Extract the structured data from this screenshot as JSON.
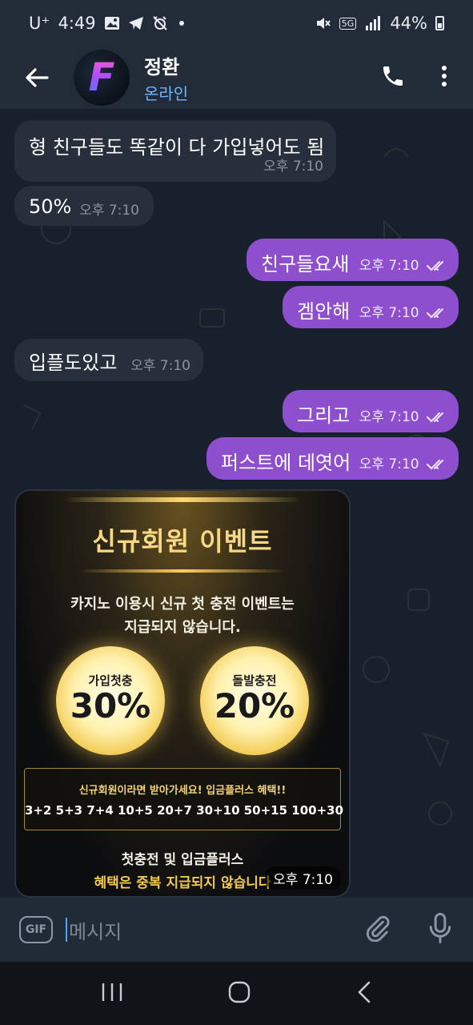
{
  "status_bar": {
    "carrier": "U⁺",
    "time": "4:49",
    "battery": "44%",
    "network": "5G"
  },
  "header": {
    "avatar_letter": "F",
    "contact_name": "정환",
    "status": "온라인",
    "back_icon": "arrow-left-icon",
    "call_icon": "phone-icon",
    "menu_icon": "more-vertical-icon"
  },
  "messages": [
    {
      "dir": "in",
      "text": "형 친구들도 똑같이 다 가입넣어도 됨",
      "time": "오후 7:10"
    },
    {
      "dir": "in",
      "text": "50%",
      "time": "오후 7:10"
    },
    {
      "dir": "out",
      "text": "친구들요새",
      "time": "오후 7:10",
      "read": true
    },
    {
      "dir": "out",
      "text": "겜안해",
      "time": "오후 7:10",
      "read": true
    },
    {
      "dir": "in",
      "text": "입플도있고",
      "time": "오후 7:10"
    },
    {
      "dir": "out",
      "text": "그리고",
      "time": "오후 7:10",
      "read": true
    },
    {
      "dir": "out",
      "text": "퍼스트에 데엿어",
      "time": "오후 7:10",
      "read": true
    }
  ],
  "promo": {
    "title": "신규회원 이벤트",
    "subtitle_line1": "카지노 이용시 신규 첫 충전 이벤트는",
    "subtitle_line2": "지급되지 않습니다.",
    "coin_left_label": "가입첫충",
    "coin_left_value": "30%",
    "coin_right_label": "돌발충전",
    "coin_right_value": "20%",
    "box_line1": "신규회원이라면 받아가세요! 입금플러스 혜택!!",
    "box_line2": "3+2 5+3 7+4 10+5 20+7 30+10 50+15 100+30",
    "footer_line1": "첫충전 및 입금플러스",
    "footer_line2": "혜택은 중복 지급되지 않습니다",
    "time": "오후 7:10"
  },
  "input_bar": {
    "gif_label": "GIF",
    "placeholder": "메시지",
    "attach_icon": "paperclip-icon",
    "mic_icon": "microphone-icon"
  },
  "nav_bar": {
    "recents_icon": "recents-icon",
    "home_icon": "home-icon",
    "back_icon": "back-icon"
  },
  "colors": {
    "outgoing_bubble": "#8e4fcf",
    "incoming_bubble": "#262f3b",
    "chat_background": "#17202b",
    "header_background": "#222b38",
    "online_status": "#6eb6ff"
  }
}
